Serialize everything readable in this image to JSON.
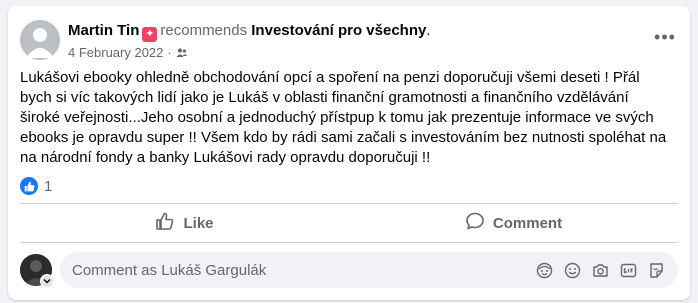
{
  "post": {
    "author": "Martin Tin",
    "recommend_badge_icon": "recommend-badge-icon",
    "recommends_word": "recommends",
    "page_name": "Investování pro všechny",
    "page_suffix": ".",
    "date": "4 February 2022",
    "date_separator": "·",
    "audience_icon": "friends-icon",
    "more_icon": "more-options-icon",
    "more_label": "•••",
    "text": "Lukášovi ebooky ohledně obchodování opcí a spoření na penzi doporučuji všemi deseti ! Přál bych si víc takových lidí jako je Lukáš v oblasti finanční gramotnosti a finančního vzdělávání široké veřejnosti...Jeho osobní a jednoduchý přístpup k tomu jak prezentuje informace ve svých ebooks je opravdu super !! Všem kdo by rádi sami začali s investováním bez nutnosti spoléhat na na národní fondy a banky Lukášovi rady opravdu doporučuji !!"
  },
  "reactions": {
    "icon": "like-reaction-icon",
    "count": "1"
  },
  "actions": {
    "like_label": "Like",
    "like_icon": "thumbs-up-icon",
    "comment_label": "Comment",
    "comment_icon": "speech-bubble-icon"
  },
  "composer": {
    "placeholder": "Comment as Lukáš Gargulák",
    "value": "",
    "tools": [
      "avatar-sticker-icon",
      "emoji-icon",
      "camera-icon",
      "gif-icon",
      "sticker-icon"
    ]
  },
  "colors": {
    "background": "#f0f2f5",
    "card": "#ffffff",
    "secondary_text": "#65676b",
    "like_blue": "#1877f2",
    "recommend_red": "#f3425f"
  }
}
